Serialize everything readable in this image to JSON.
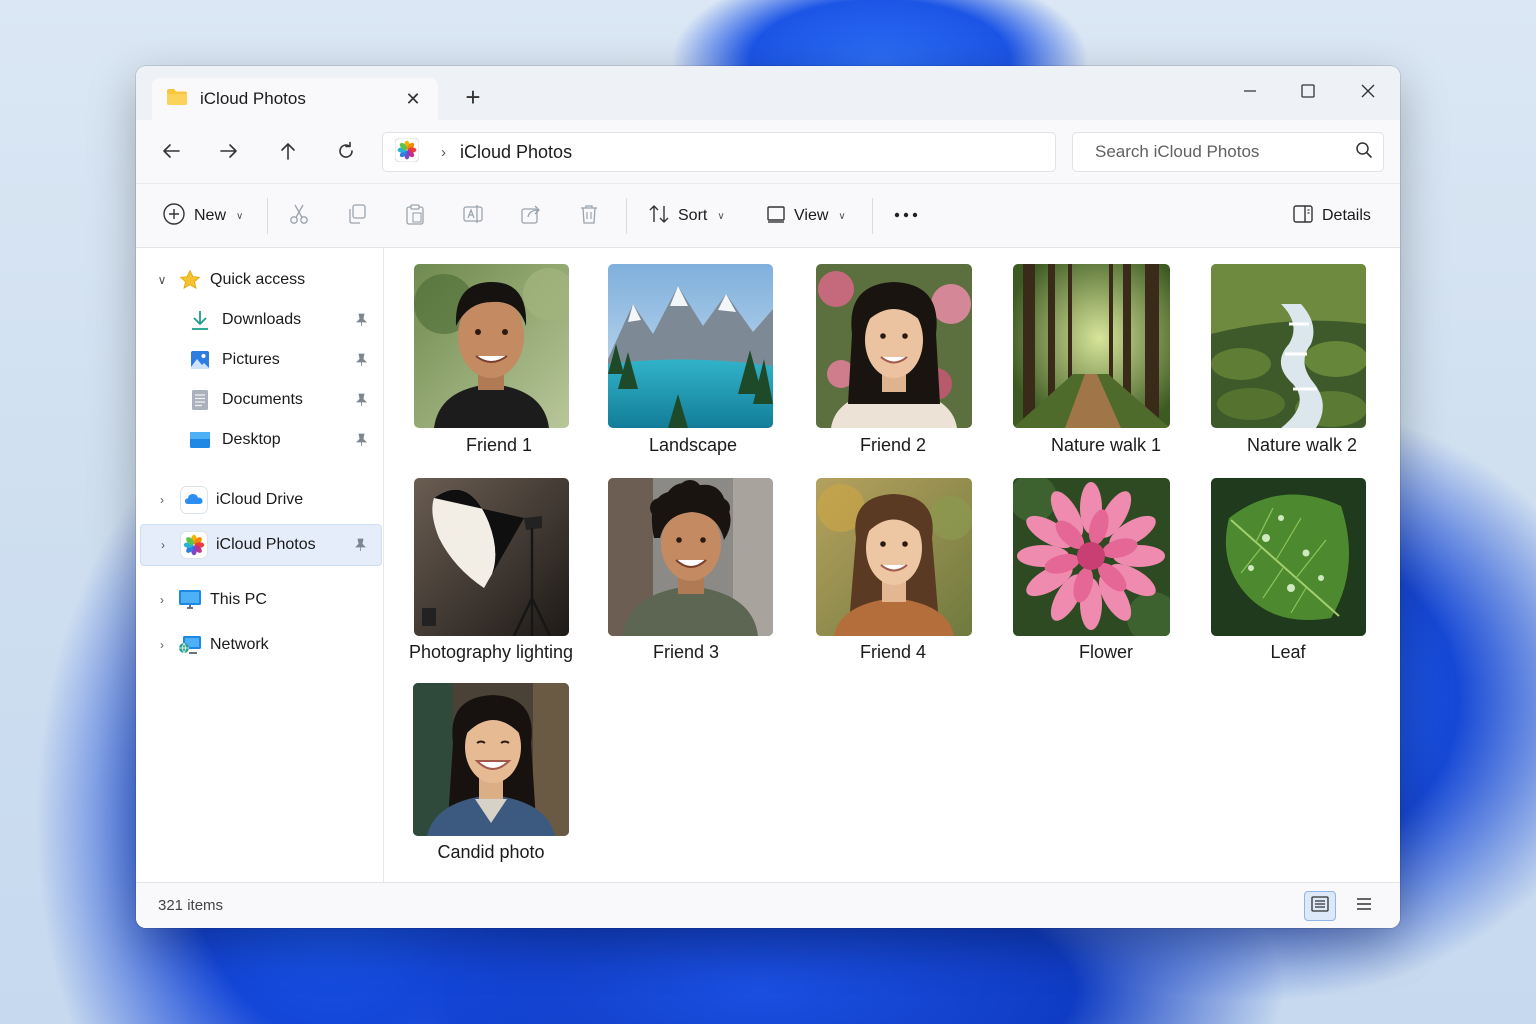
{
  "tab": {
    "title": "iCloud Photos"
  },
  "address": {
    "current": "iCloud Photos"
  },
  "search": {
    "placeholder": "Search iCloud Photos"
  },
  "toolbar": {
    "new_label": "New",
    "sort_label": "Sort",
    "view_label": "View",
    "details_label": "Details"
  },
  "sidebar": {
    "quick_access": "Quick access",
    "pinned": [
      "Downloads",
      "Pictures",
      "Documents",
      "Desktop"
    ],
    "icloud_drive": "iCloud Drive",
    "icloud_photos": "iCloud Photos",
    "this_pc": "This PC",
    "network": "Network"
  },
  "files": [
    {
      "name": "Friend 1",
      "icon": "portrait-photo"
    },
    {
      "name": "Landscape",
      "icon": "mountain-lake-photo"
    },
    {
      "name": "Friend 2",
      "icon": "portrait-photo"
    },
    {
      "name": "Nature walk 1",
      "icon": "forest-path-photo"
    },
    {
      "name": "Nature walk 2",
      "icon": "forest-stream-photo"
    },
    {
      "name": "Photography lighting",
      "icon": "studio-light-photo"
    },
    {
      "name": "Friend 3",
      "icon": "portrait-photo"
    },
    {
      "name": "Friend 4",
      "icon": "portrait-photo"
    },
    {
      "name": "Flower",
      "icon": "flower-photo"
    },
    {
      "name": "Leaf",
      "icon": "leaf-photo"
    },
    {
      "name": "Candid photo",
      "icon": "portrait-photo"
    }
  ],
  "status": {
    "item_count": "321 items"
  },
  "colors": {
    "accent": "#0067c0",
    "selected_bg": "#e4edf9",
    "folder_yellow": "#f8c63d"
  }
}
